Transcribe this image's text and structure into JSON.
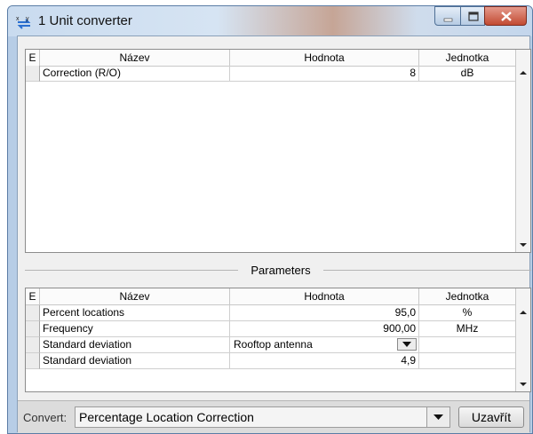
{
  "window": {
    "title": "1 Unit converter",
    "icon": "unit-converter-icon"
  },
  "columns": {
    "e": "E",
    "name": "Název",
    "value": "Hodnota",
    "unit": "Jednotka"
  },
  "top_table": {
    "rows": [
      {
        "name": "Correction (R/O)",
        "value": "8",
        "unit": "dB"
      }
    ]
  },
  "parameters": {
    "title": "Parameters",
    "rows": [
      {
        "name": "Percent locations",
        "value": "95,0",
        "unit": "%"
      },
      {
        "name": "Frequency",
        "value": "900,00",
        "unit": "MHz"
      },
      {
        "name": "Standard deviation",
        "value": "Rooftop antenna",
        "unit": ""
      },
      {
        "name": "Standard deviation",
        "value": "4,9",
        "unit": ""
      }
    ]
  },
  "bottom": {
    "convert_label": "Convert:",
    "convert_value": "Percentage Location Correction",
    "close_label": "Uzavřít"
  }
}
